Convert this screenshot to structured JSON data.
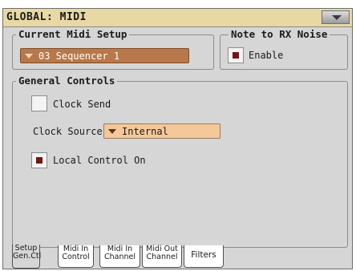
{
  "window": {
    "title": "GLOBAL: MIDI",
    "menu_icon": "triangle-down-icon"
  },
  "current_midi_setup": {
    "group_title": "Current Midi Setup",
    "selected_value": "03 Sequencer 1"
  },
  "note_to_rx_noise": {
    "group_title": "Note to RX Noise",
    "enable_label": "Enable",
    "enable_checked": true
  },
  "general_controls": {
    "group_title": "General Controls",
    "clock_send_label": "Clock Send",
    "clock_send_checked": false,
    "clock_source_label": "Clock Source:",
    "clock_source_value": "Internal",
    "local_control_label": "Local Control On",
    "local_control_checked": true
  },
  "tabs": [
    {
      "line1": "Setup",
      "line2": "Gen.Ctl",
      "active": true
    },
    {
      "line1": "Midi In",
      "line2": "Control",
      "active": false
    },
    {
      "line1": "Midi In",
      "line2": "Channel",
      "active": false
    },
    {
      "line1": "Midi Out",
      "line2": "Channel",
      "active": false
    },
    {
      "line1": "Filters",
      "line2": "",
      "active": false
    }
  ],
  "colors": {
    "title_bar": "#e8d8a4",
    "panel_bg": "#d6d6d6",
    "combo_light": "#f5c89a",
    "combo_dark": "#b8784a",
    "check_mark": "#7a1212"
  }
}
